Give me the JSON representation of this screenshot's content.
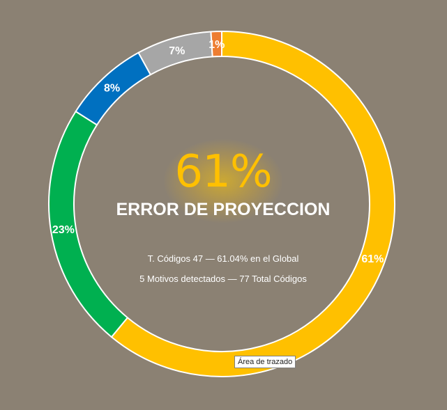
{
  "chart_data": {
    "type": "pie",
    "variant": "doughnut",
    "slices": [
      {
        "label": "61%",
        "value": 61,
        "color": "#ffc000"
      },
      {
        "label": "23%",
        "value": 23,
        "color": "#00b050"
      },
      {
        "label": "8%",
        "value": 8,
        "color": "#0070c0"
      },
      {
        "label": "7%",
        "value": 7,
        "color": "#a6a6a6"
      },
      {
        "label": "1%",
        "value": 1,
        "color": "#ed7d31"
      }
    ]
  },
  "center": {
    "percent": "61%",
    "title": "ERROR DE PROYECCION",
    "line1": "T. Códigos 47 — 61.04% en el Global",
    "line2": "5 Motivos detectados — 77 Total Códigos"
  },
  "tooltip": "Área de trazado",
  "colors": {
    "background": "#8b8173",
    "ring_border": "#ffffff"
  }
}
